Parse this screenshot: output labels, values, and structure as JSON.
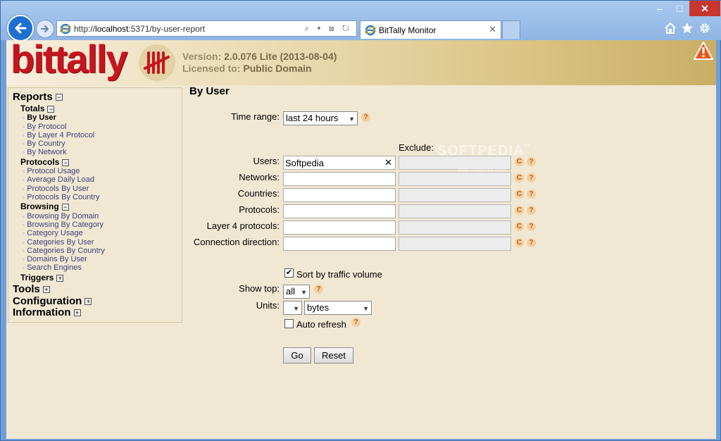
{
  "browser": {
    "url_prefix": "http://",
    "url_host": "localhost",
    "url_rest": ":5371/by-user-report",
    "tab_title": "BitTally Monitor",
    "window_buttons": {
      "minimize": "–",
      "maximize": "□",
      "close": "✕"
    },
    "address_tools": "⌕ ▾ ⊠ ↻"
  },
  "header": {
    "logo": "bittally",
    "version_label": "Version:",
    "version_value": "2.0.076 Lite (2013-08-04)",
    "licensed_label": "Licensed to:",
    "licensed_value": "Public Domain"
  },
  "sidebar": {
    "reports": "Reports",
    "totals": "Totals",
    "totals_items": [
      "By User",
      "By Protocol",
      "By Layer 4 Protocol",
      "By Country",
      "By Network"
    ],
    "protocols": "Protocols",
    "protocols_items": [
      "Protocol Usage",
      "Average Daily Load",
      "Protocols By User",
      "Protocols By Country"
    ],
    "browsing": "Browsing",
    "browsing_items": [
      "Browsing By Domain",
      "Browsing By Category",
      "Category Usage",
      "Categories By User",
      "Categories By Country",
      "Domains By User",
      "Search Engines"
    ],
    "triggers": "Triggers",
    "tools": "Tools",
    "configuration": "Configuration",
    "information": "Information",
    "collapse": "−",
    "expand": "+"
  },
  "main": {
    "title": "By User",
    "time_range_label": "Time range:",
    "time_range_value": "last 24 hours",
    "exclude_label": "Exclude:",
    "filters": [
      {
        "label": "Users:",
        "value": "Softpedia",
        "clear": "✕"
      },
      {
        "label": "Networks:",
        "value": ""
      },
      {
        "label": "Countries:",
        "value": ""
      },
      {
        "label": "Protocols:",
        "value": ""
      },
      {
        "label": "Layer 4 protocols:",
        "value": ""
      },
      {
        "label": "Connection direction:",
        "value": ""
      }
    ],
    "sort_label": "Sort by traffic volume",
    "sort_checked": "✔",
    "show_top_label": "Show top:",
    "show_top_value": "all",
    "units_label": "Units:",
    "units_prefix_value": "",
    "units_value": "bytes",
    "auto_refresh_label": "Auto refresh",
    "go_label": "Go",
    "reset_label": "Reset",
    "help_glyph": "?",
    "reset_glyph": "C"
  },
  "watermark": {
    "text": "SOFTPEDIA",
    "sub": "www.softpedia.com",
    "tm": "™"
  }
}
